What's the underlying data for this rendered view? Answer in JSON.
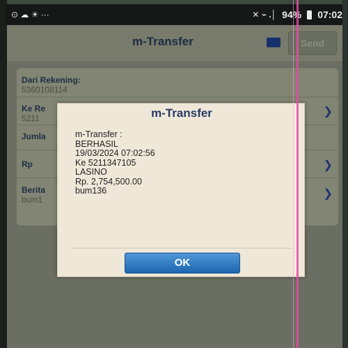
{
  "status_bar": {
    "left_text": "⊙ ☁ ☀ ···",
    "signal_text": "✕ ⌁ .│",
    "battery": "94%",
    "time": "07:02"
  },
  "app": {
    "title": "m-Transfer",
    "send_label": "Send",
    "form": {
      "from_account_label": "Dari Rekening:",
      "from_account_value": "5360108114",
      "to_label": "Ke Re",
      "to_value": "5211",
      "amount_label": "Jumla",
      "rp_label": "Rp",
      "message_label": "Berita",
      "message_value": "bum1"
    }
  },
  "dialog": {
    "title": "m-Transfer",
    "message": "m-Transfer :\nBERHASIL\n19/03/2024 07:02:56\nKe 5211347105\nLASINO\nRp. 2,754,500.00\nbum136",
    "ok_label": "OK"
  },
  "colors": {
    "dialog_bg": "#efe8d9",
    "ok_button": "#2f7ac4",
    "title_text": "#283a62"
  }
}
